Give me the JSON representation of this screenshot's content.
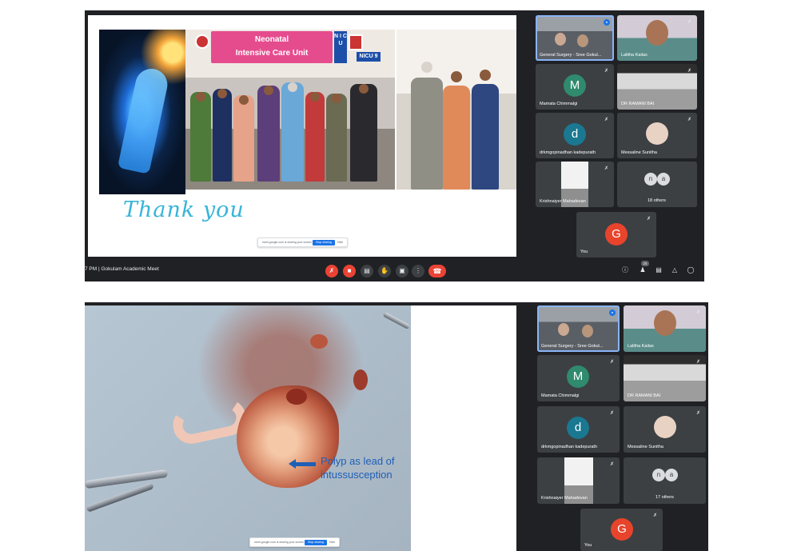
{
  "screenshot_top": {
    "slide": {
      "sign_top": "Neonatal",
      "sign_bottom": "Intensive Care Unit",
      "side_sign": "N I C U",
      "wing_sign": "NICU 9",
      "closing_text": "Thank you"
    },
    "share_bar": {
      "text": "meet.google.com is sharing your screen",
      "stop_label": "Stop sharing",
      "hide_label": "Hide"
    },
    "participants": [
      {
        "name": "General Surgery - Sree Gokul...",
        "kind": "video"
      },
      {
        "name": "Lalitha Kailas",
        "kind": "video"
      },
      {
        "name": "Mamata Chimmalgi",
        "initial": "M"
      },
      {
        "name": "DR RAMANI BAI",
        "kind": "video"
      },
      {
        "name": "drkmgopinadhan kadepurath",
        "initial": "d"
      },
      {
        "name": "Messaline Sunitha",
        "kind": "video"
      },
      {
        "name": "Krishnaiyer Mahadevan",
        "kind": "video"
      },
      {
        "name": "18 others",
        "initials": [
          "n",
          "a"
        ]
      },
      {
        "name": "You",
        "initial": "G"
      }
    ],
    "toolbar": {
      "time": "7 PM",
      "separator": "|",
      "meeting_name": "Gokulam Academic Meet",
      "participant_count": "25"
    }
  },
  "screenshot_bottom": {
    "slide": {
      "annotation_line1": "Polyp as lead of",
      "annotation_line2": "intussusception"
    },
    "share_bar": {
      "text": "meet.google.com is sharing your screen",
      "stop_label": "Stop sharing",
      "hide_label": "Hide"
    },
    "participants": [
      {
        "name": "General Surgery - Sree Gokul...",
        "kind": "video"
      },
      {
        "name": "Lalitha Kailas",
        "kind": "video"
      },
      {
        "name": "Mamata Chimmalgi",
        "initial": "M"
      },
      {
        "name": "DR RAMANI BAI",
        "kind": "video"
      },
      {
        "name": "drkmgopinadhan kadepurath",
        "initial": "d"
      },
      {
        "name": "Messaline Sunitha",
        "kind": "video"
      },
      {
        "name": "Krishnaiyer Mahadevan",
        "kind": "video"
      },
      {
        "name": "17 others",
        "initials": [
          "n",
          "a"
        ]
      },
      {
        "name": "You",
        "initial": "G"
      }
    ]
  },
  "icons": {
    "mic_off": "mic-off-icon",
    "cam_off": "camera-off-icon",
    "captions": "captions-icon",
    "raise_hand": "raise-hand-icon",
    "present": "present-icon",
    "more": "more-options-icon",
    "end_call": "end-call-icon",
    "info": "info-icon",
    "people": "people-icon",
    "chat": "chat-icon",
    "activities": "activities-icon",
    "host_controls": "host-controls-icon"
  },
  "colors": {
    "meet_bg": "#202124",
    "tile_bg": "#3c4043",
    "danger": "#ea4335",
    "accent": "#1a73e8",
    "thank_you": "#37b4d9",
    "annotation": "#1f5fb5"
  }
}
